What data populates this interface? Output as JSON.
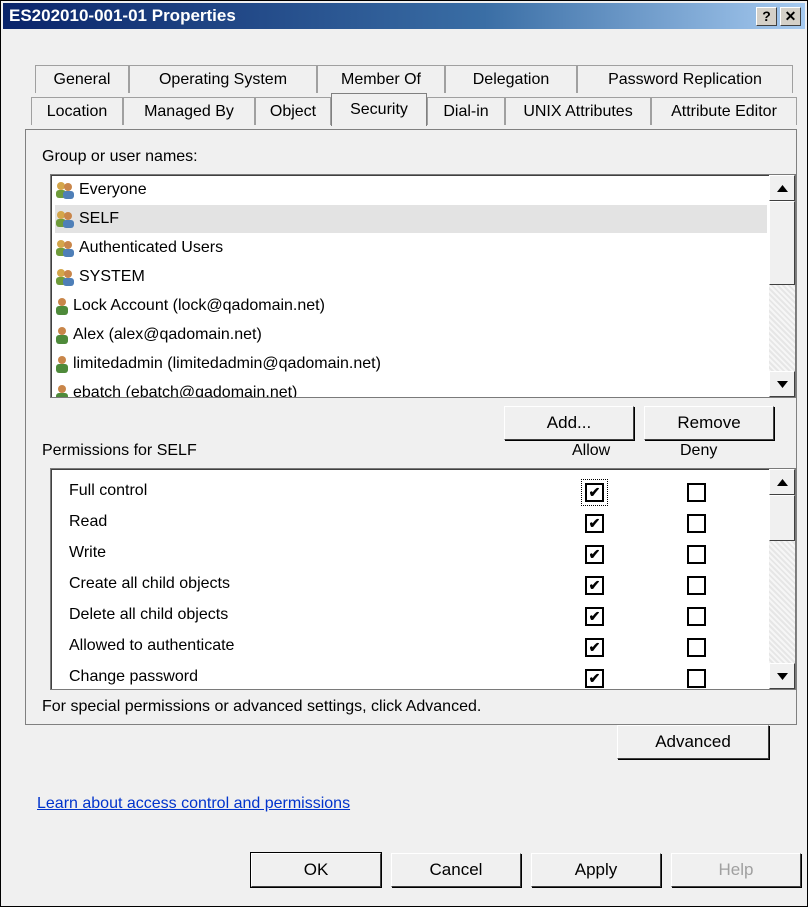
{
  "window": {
    "title": "ES202010-001-01 Properties",
    "help_btn": "?",
    "close_btn": "✕"
  },
  "tabs_row1": [
    "General",
    "Operating System",
    "Member Of",
    "Delegation",
    "Password Replication"
  ],
  "tabs_row2": [
    "Location",
    "Managed By",
    "Object",
    "Security",
    "Dial-in",
    "UNIX Attributes",
    "Attribute Editor"
  ],
  "active_tab": "Security",
  "group_label": "Group or user names:",
  "users": [
    {
      "name": "Everyone",
      "icon": "group-icon"
    },
    {
      "name": "SELF",
      "icon": "group-icon",
      "selected": true
    },
    {
      "name": "Authenticated Users",
      "icon": "group-icon"
    },
    {
      "name": "SYSTEM",
      "icon": "group-icon"
    },
    {
      "name": "Lock Account (lock@qadomain.net)",
      "icon": "user-icon"
    },
    {
      "name": "Alex (alex@qadomain.net)",
      "icon": "user-icon"
    },
    {
      "name": "limitedadmin (limitedadmin@qadomain.net)",
      "icon": "user-icon"
    },
    {
      "name": "ebatch (ebatch@qadomain.net)",
      "icon": "user-icon"
    }
  ],
  "add_button": "Add...",
  "remove_button": "Remove",
  "permissions_label": "Permissions for SELF",
  "allow_header": "Allow",
  "deny_header": "Deny",
  "permissions": [
    {
      "name": "Full control",
      "allow": true,
      "deny": false
    },
    {
      "name": "Read",
      "allow": true,
      "deny": false
    },
    {
      "name": "Write",
      "allow": true,
      "deny": false
    },
    {
      "name": "Create all child objects",
      "allow": true,
      "deny": false
    },
    {
      "name": "Delete all child objects",
      "allow": true,
      "deny": false
    },
    {
      "name": "Allowed to authenticate",
      "allow": true,
      "deny": false
    },
    {
      "name": "Change password",
      "allow": true,
      "deny": false
    }
  ],
  "advanced_hint": "For special permissions or advanced settings, click Advanced.",
  "advanced_button": "Advanced",
  "learn_link": "Learn about access control and permissions",
  "footer": {
    "ok": "OK",
    "cancel": "Cancel",
    "apply": "Apply",
    "help": "Help"
  },
  "check_mark": "✔"
}
